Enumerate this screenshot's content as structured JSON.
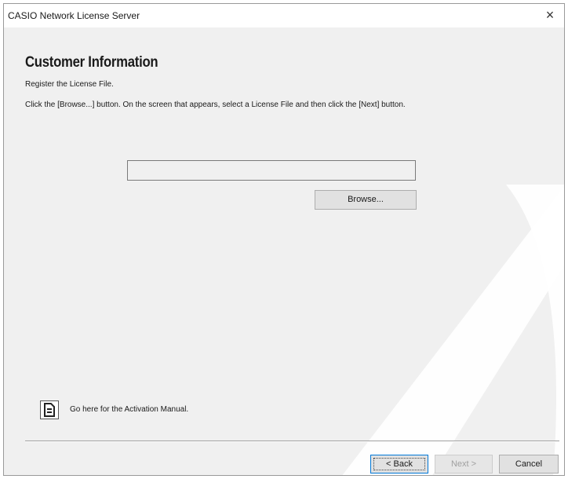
{
  "window": {
    "title": "CASIO Network License Server",
    "close_glyph": "×"
  },
  "page": {
    "title": "Customer Information",
    "subtitle": "Register the License File.",
    "instruction": "Click the [Browse...] button. On the screen that appears, select a License File and then click the [Next] button."
  },
  "license_file": {
    "value": "",
    "browse_label": "Browse..."
  },
  "manual": {
    "icon": "document-icon",
    "link_label": "Go here for the Activation Manual."
  },
  "footer": {
    "back_label": "< Back",
    "next_label": "Next >",
    "cancel_label": "Cancel",
    "next_enabled": false
  },
  "colors": {
    "window_bg": "#f0f0f0",
    "titlebar_bg": "#ffffff",
    "focus_border": "#0078d7",
    "watermark": "#e6e6e6"
  }
}
